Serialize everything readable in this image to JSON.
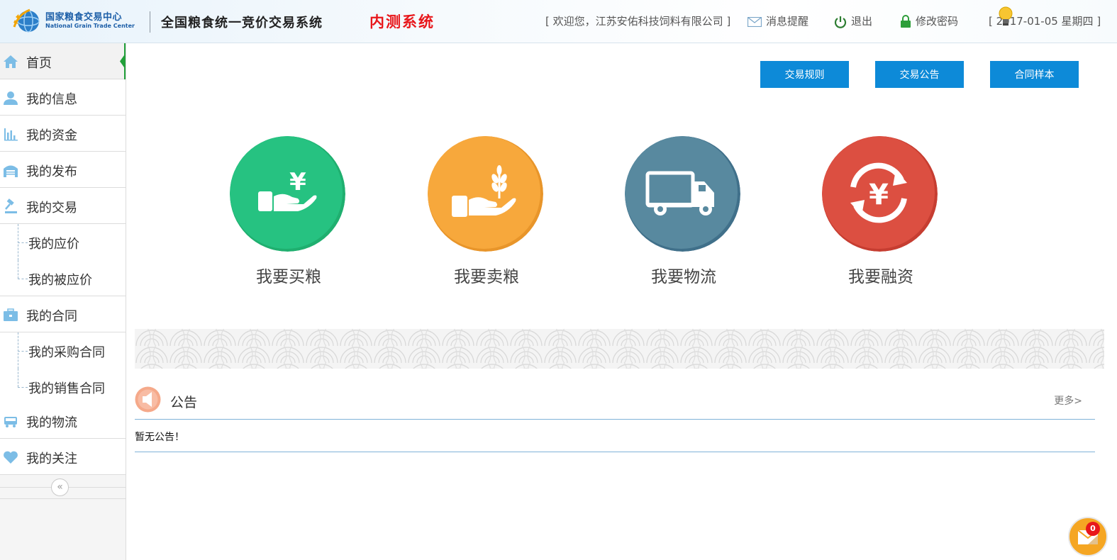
{
  "header": {
    "logo_cn": "国家粮食交易中心",
    "logo_en": "National Grain Trade Center",
    "system_title": "全国粮食统一竞价交易系统",
    "system_badge": "内测系统",
    "welcome": "[ 欢迎您，江苏安佑科技饲料有限公司 ]",
    "messages": "消息提醒",
    "logout": "退出",
    "change_password": "修改密码",
    "date": "[ 2017-01-05 星期四 ]"
  },
  "sidebar": {
    "items": [
      {
        "label": "首页",
        "icon": "home-icon"
      },
      {
        "label": "我的信息",
        "icon": "user-icon"
      },
      {
        "label": "我的资金",
        "icon": "bar-chart-icon"
      },
      {
        "label": "我的发布",
        "icon": "warehouse-icon"
      },
      {
        "label": "我的交易",
        "icon": "gavel-icon"
      },
      {
        "label": "我的应价"
      },
      {
        "label": "我的被应价"
      },
      {
        "label": "我的合同",
        "icon": "briefcase-icon"
      },
      {
        "label": "我的采购合同"
      },
      {
        "label": "我的销售合同"
      },
      {
        "label": "我的物流",
        "icon": "truck-icon"
      },
      {
        "label": "我的关注",
        "icon": "heart-icon"
      }
    ],
    "collapse_glyph": "«"
  },
  "toolbar": {
    "rules": "交易规则",
    "announcements": "交易公告",
    "contract_samples": "合同样本"
  },
  "features": [
    {
      "label": "我要买粮",
      "color": "#26c281",
      "icon": "buy-grain-icon"
    },
    {
      "label": "我要卖粮",
      "color": "#f7a83c",
      "icon": "sell-grain-icon"
    },
    {
      "label": "我要物流",
      "color": "#58899f",
      "icon": "logistics-truck-icon"
    },
    {
      "label": "我要融资",
      "color": "#dc4f41",
      "icon": "finance-cycle-icon"
    }
  ],
  "notice": {
    "title": "公告",
    "more": "更多>",
    "empty": "暂无公告！"
  },
  "mail_badge_count": "0",
  "colors": {
    "primary_button": "#0d8ad8",
    "badge_red": "#e8171b",
    "active_marker": "#22a03a"
  }
}
